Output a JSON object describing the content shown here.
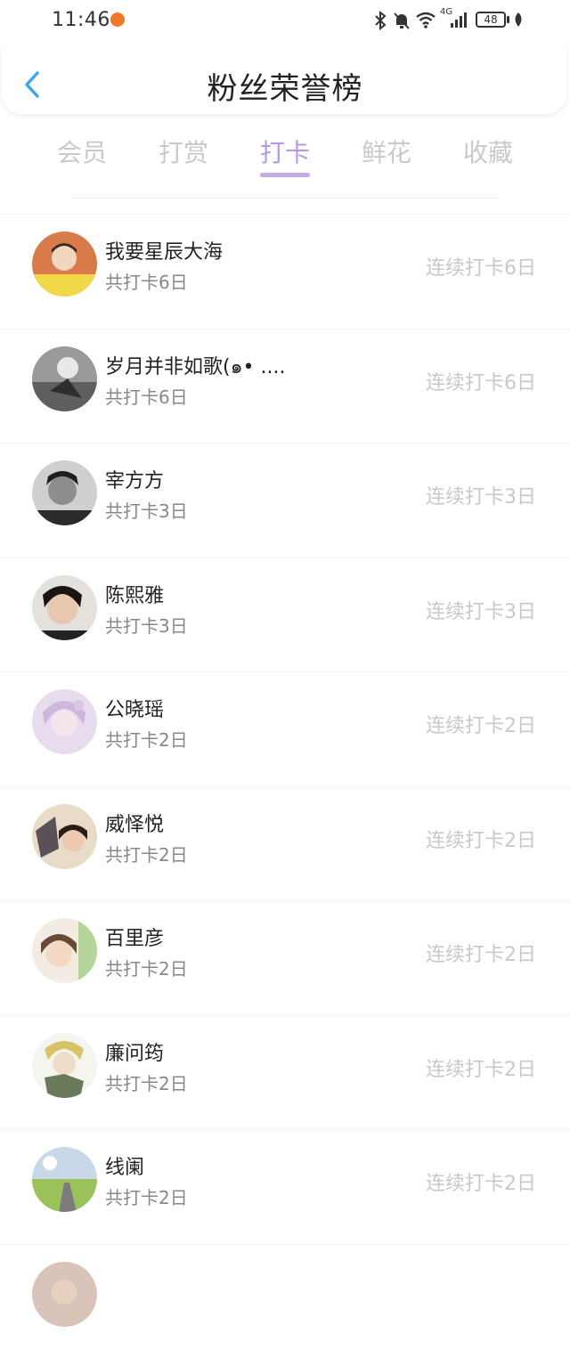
{
  "status_bar": {
    "time": "11:46",
    "network": "4G",
    "battery": "48"
  },
  "header": {
    "title": "粉丝荣誉榜"
  },
  "tabs": [
    {
      "label": "会员"
    },
    {
      "label": "打赏"
    },
    {
      "label": "打卡",
      "active": true
    },
    {
      "label": "鲜花"
    },
    {
      "label": "收藏"
    }
  ],
  "fans": [
    {
      "name": "我要星辰大海",
      "total": "共打卡6日",
      "streak": "连续打卡6日"
    },
    {
      "name": "岁月并非如歌(๑• ....",
      "total": "共打卡6日",
      "streak": "连续打卡6日"
    },
    {
      "name": "宰方方",
      "total": "共打卡3日",
      "streak": "连续打卡3日"
    },
    {
      "name": "陈熙雅",
      "total": "共打卡3日",
      "streak": "连续打卡3日"
    },
    {
      "name": "公晓瑶",
      "total": "共打卡2日",
      "streak": "连续打卡2日"
    },
    {
      "name": "威怿悦",
      "total": "共打卡2日",
      "streak": "连续打卡2日"
    },
    {
      "name": "百里彦",
      "total": "共打卡2日",
      "streak": "连续打卡2日"
    },
    {
      "name": "廉问筠",
      "total": "共打卡2日",
      "streak": "连续打卡2日"
    },
    {
      "name": "线阑",
      "total": "共打卡2日",
      "streak": "连续打卡2日"
    }
  ],
  "colors": {
    "accent": "#b59ae0",
    "tab_inactive": "#c9c9c9",
    "streak_text": "#c8c8c8",
    "back_icon": "#3ea6f0"
  },
  "icons": [
    "back-icon",
    "bluetooth-icon",
    "mute-icon",
    "wifi-icon",
    "signal-icon",
    "battery-icon",
    "leaf-icon"
  ]
}
